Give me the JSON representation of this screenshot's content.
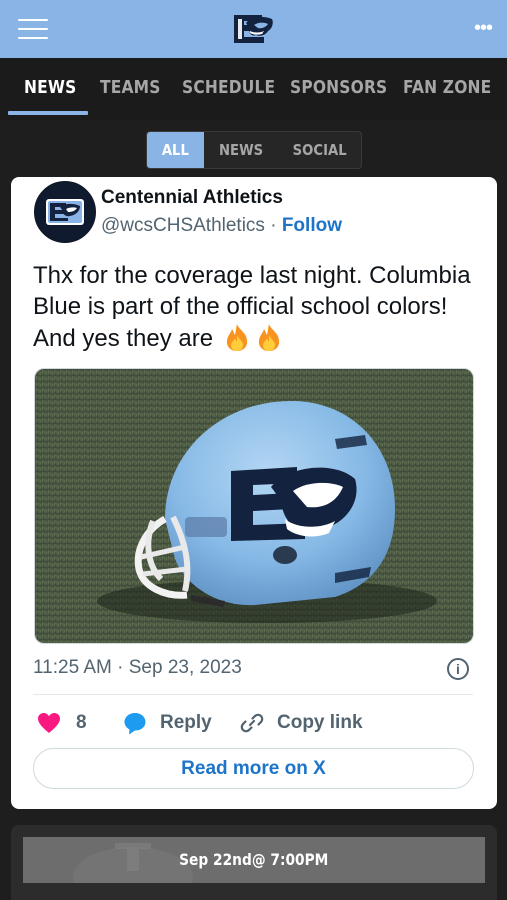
{
  "app": {
    "logo_name": "team-logo",
    "brand_color": "#8ab4e6",
    "more_glyph": "•••"
  },
  "nav": {
    "tabs": [
      {
        "label": "NEWS",
        "active": true
      },
      {
        "label": "TEAMS",
        "active": false
      },
      {
        "label": "SCHEDULE",
        "active": false
      },
      {
        "label": "SPONSORS",
        "active": false
      },
      {
        "label": "FAN ZONE",
        "active": false
      }
    ]
  },
  "filter": {
    "options": [
      {
        "label": "ALL",
        "active": true
      },
      {
        "label": "NEWS",
        "active": false
      },
      {
        "label": "SOCIAL",
        "active": false
      }
    ]
  },
  "tweet": {
    "author": "Centennial Athletics",
    "handle": "@wcsCHSAthletics",
    "separator": "·",
    "follow_label": "Follow",
    "text": "Thx for the coverage last night. Columbia Blue is part of the official school colors! And yes they are",
    "emoji": [
      "fire",
      "fire"
    ],
    "image_subject": "football-helmet-on-turf",
    "timestamp": "11:25 AM · Sep 23, 2023",
    "info_glyph": "i",
    "like_count": "8",
    "reply_label": "Reply",
    "copy_link_label": "Copy link",
    "read_more_label": "Read more on X",
    "colors": {
      "link": "#1d74c9",
      "heart": "#f91880",
      "reply": "#1d9bf0",
      "muted": "#536471"
    }
  },
  "game": {
    "date_label": "Sep 22nd@ 7:00PM"
  }
}
